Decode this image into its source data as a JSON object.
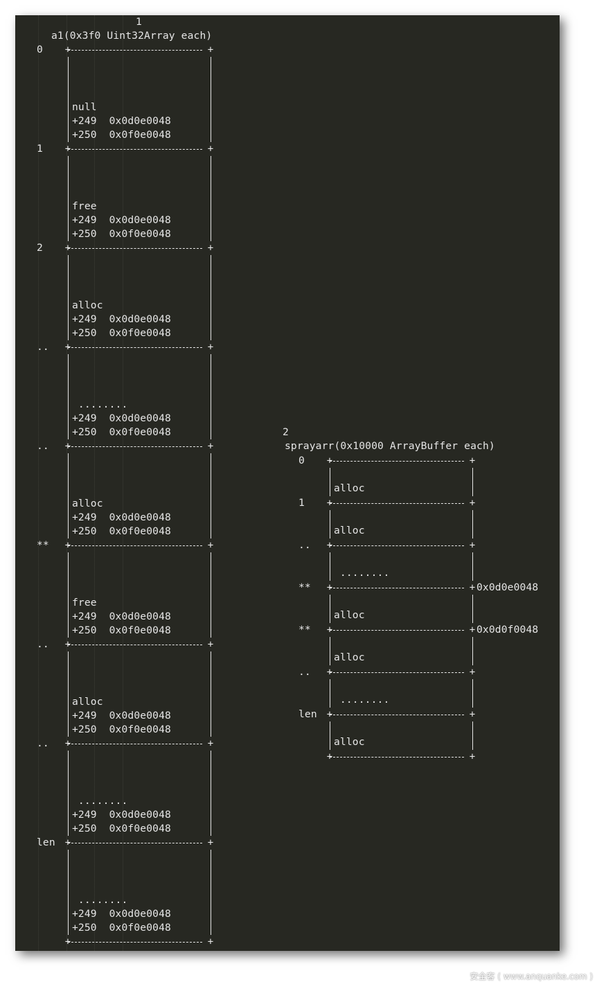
{
  "left": {
    "figure_number": "1",
    "title": "a1(0x3f0 Uint32Array each)",
    "chunks": [
      {
        "index": "0",
        "status": "null",
        "lines": [
          "+249  0x0d0e0048",
          "+250  0x0f0e0048"
        ]
      },
      {
        "index": "1",
        "status": "free",
        "lines": [
          "+249  0x0d0e0048",
          "+250  0x0f0e0048"
        ]
      },
      {
        "index": "2",
        "status": "alloc",
        "lines": [
          "+249  0x0d0e0048",
          "+250  0x0f0e0048"
        ]
      },
      {
        "index": "..",
        "status": " ........",
        "lines": [
          "+249  0x0d0e0048",
          "+250  0x0f0e0048"
        ]
      },
      {
        "index": "..",
        "status": "alloc",
        "lines": [
          "+249  0x0d0e0048",
          "+250  0x0f0e0048"
        ]
      },
      {
        "index": "**",
        "status": "free",
        "lines": [
          "+249  0x0d0e0048",
          "+250  0x0f0e0048"
        ]
      },
      {
        "index": "..",
        "status": "alloc",
        "lines": [
          "+249  0x0d0e0048",
          "+250  0x0f0e0048"
        ]
      },
      {
        "index": "..",
        "status": " ........",
        "lines": [
          "+249  0x0d0e0048",
          "+250  0x0f0e0048"
        ]
      },
      {
        "index": "len",
        "status": " ........",
        "lines": [
          "+249  0x0d0e0048",
          "+250  0x0f0e0048"
        ]
      }
    ]
  },
  "right": {
    "figure_number": "2",
    "title": "sprayarr(0x10000 ArrayBuffer each)",
    "chunks": [
      {
        "index": "0",
        "status": "alloc",
        "pointer": ""
      },
      {
        "index": "1",
        "status": "alloc",
        "pointer": ""
      },
      {
        "index": "..",
        "status": " ........",
        "pointer": ""
      },
      {
        "index": "**",
        "status": "alloc",
        "pointer": "0x0d0e0048"
      },
      {
        "index": "**",
        "status": "alloc",
        "pointer": "0x0d0f0048"
      },
      {
        "index": "..",
        "status": " ........",
        "pointer": ""
      },
      {
        "index": "len",
        "status": "alloc",
        "pointer": ""
      }
    ]
  },
  "watermark": "安全客 ( www.anquanke.com )"
}
